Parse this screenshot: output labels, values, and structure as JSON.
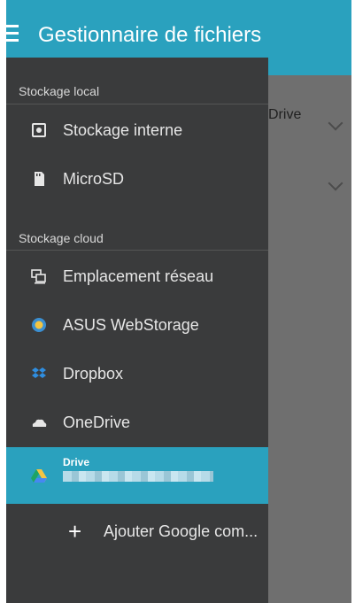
{
  "appbar": {
    "title": "Gestionnaire de fichiers"
  },
  "background": {
    "row1_text": "Drive"
  },
  "drawer": {
    "local_header": "Stockage local",
    "local_items": [
      {
        "label": "Stockage interne",
        "icon": "internal-storage-icon"
      },
      {
        "label": "MicroSD",
        "icon": "sd-card-icon"
      }
    ],
    "cloud_header": "Stockage cloud",
    "cloud_items": [
      {
        "label": "Emplacement réseau",
        "icon": "network-location-icon"
      },
      {
        "label": "ASUS WebStorage",
        "icon": "asus-webstorage-icon"
      },
      {
        "label": "Dropbox",
        "icon": "dropbox-icon"
      },
      {
        "label": "OneDrive",
        "icon": "onedrive-icon"
      }
    ],
    "selected_item": {
      "title": "Drive",
      "icon": "google-drive-icon"
    },
    "add_item": {
      "label": "Ajouter Google com..."
    }
  },
  "colors": {
    "accent": "#2aa1be",
    "drawer_bg": "#3a3b3c",
    "scrim": "#6f6f6f"
  }
}
